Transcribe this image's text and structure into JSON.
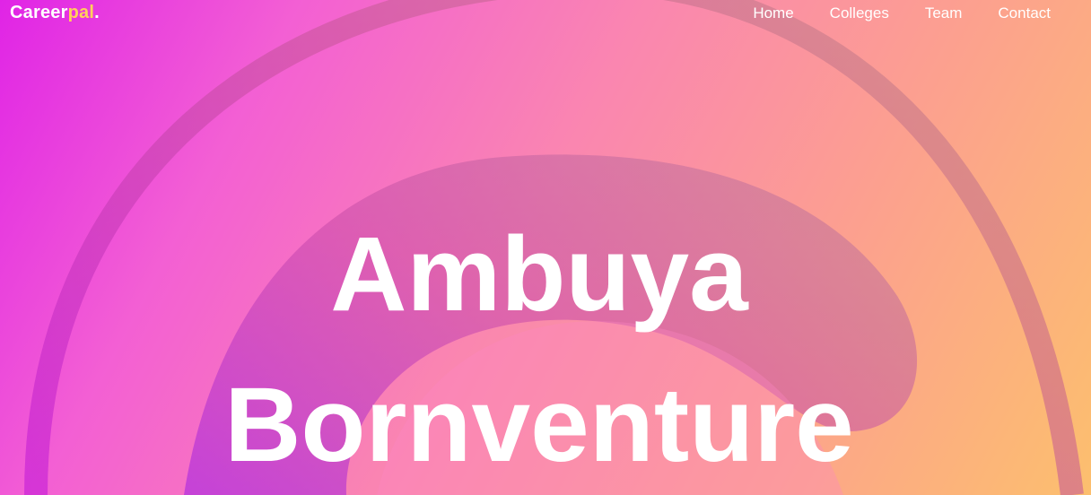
{
  "brand": {
    "name_main": "Career",
    "name_accent": "pal",
    "name_dot": ".",
    "accent_color": "#ffd15a"
  },
  "nav": {
    "items": [
      {
        "label": "Home"
      },
      {
        "label": "Colleges"
      },
      {
        "label": "Team"
      },
      {
        "label": "Contact"
      }
    ]
  },
  "hero": {
    "title_line1": "Ambuya",
    "title_line2": "Bornventure",
    "gradient_colors": [
      "#e024e6",
      "#f35fd4",
      "#fa86b0",
      "#fca08f",
      "#fcbf6e"
    ]
  }
}
